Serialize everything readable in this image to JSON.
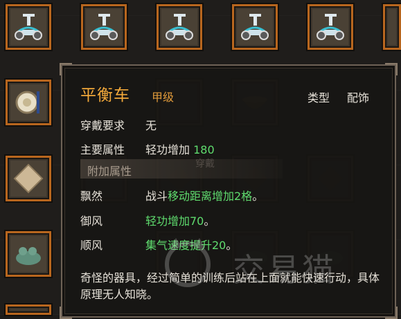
{
  "item": {
    "name": "平衡车",
    "grade": "甲级",
    "type_label": "类型",
    "type_value": "配饰",
    "requirement_label": "穿戴要求",
    "requirement_value": "无",
    "main_attr_label": "主要属性",
    "main_attr_text": "轻功增加",
    "main_attr_value": "180",
    "extra_section": "附加属性",
    "extra": [
      {
        "name": "飘然",
        "prefix": "战斗",
        "highlight": "移动距离增加2格",
        "suffix": "。"
      },
      {
        "name": "御风",
        "prefix": "",
        "highlight": "轻功增加70",
        "suffix": "。"
      },
      {
        "name": "顺风",
        "prefix": "",
        "highlight": "集气速度提升20",
        "suffix": "。"
      }
    ],
    "description": "奇怪的器具，经过简单的训练后站在上面就能快速行动，具体原理无人知晓。"
  },
  "watermark": "交易猫",
  "ghost_text": "穿戴",
  "icons": [
    "balance-scooter-icon",
    "gong-icon",
    "paper-icon",
    "jade-toad-icon",
    "bowl-icon"
  ],
  "colors": {
    "frame": "#b8661e",
    "title": "#f2a83a",
    "green": "#5fdc6e",
    "text": "#e6e1d8"
  }
}
